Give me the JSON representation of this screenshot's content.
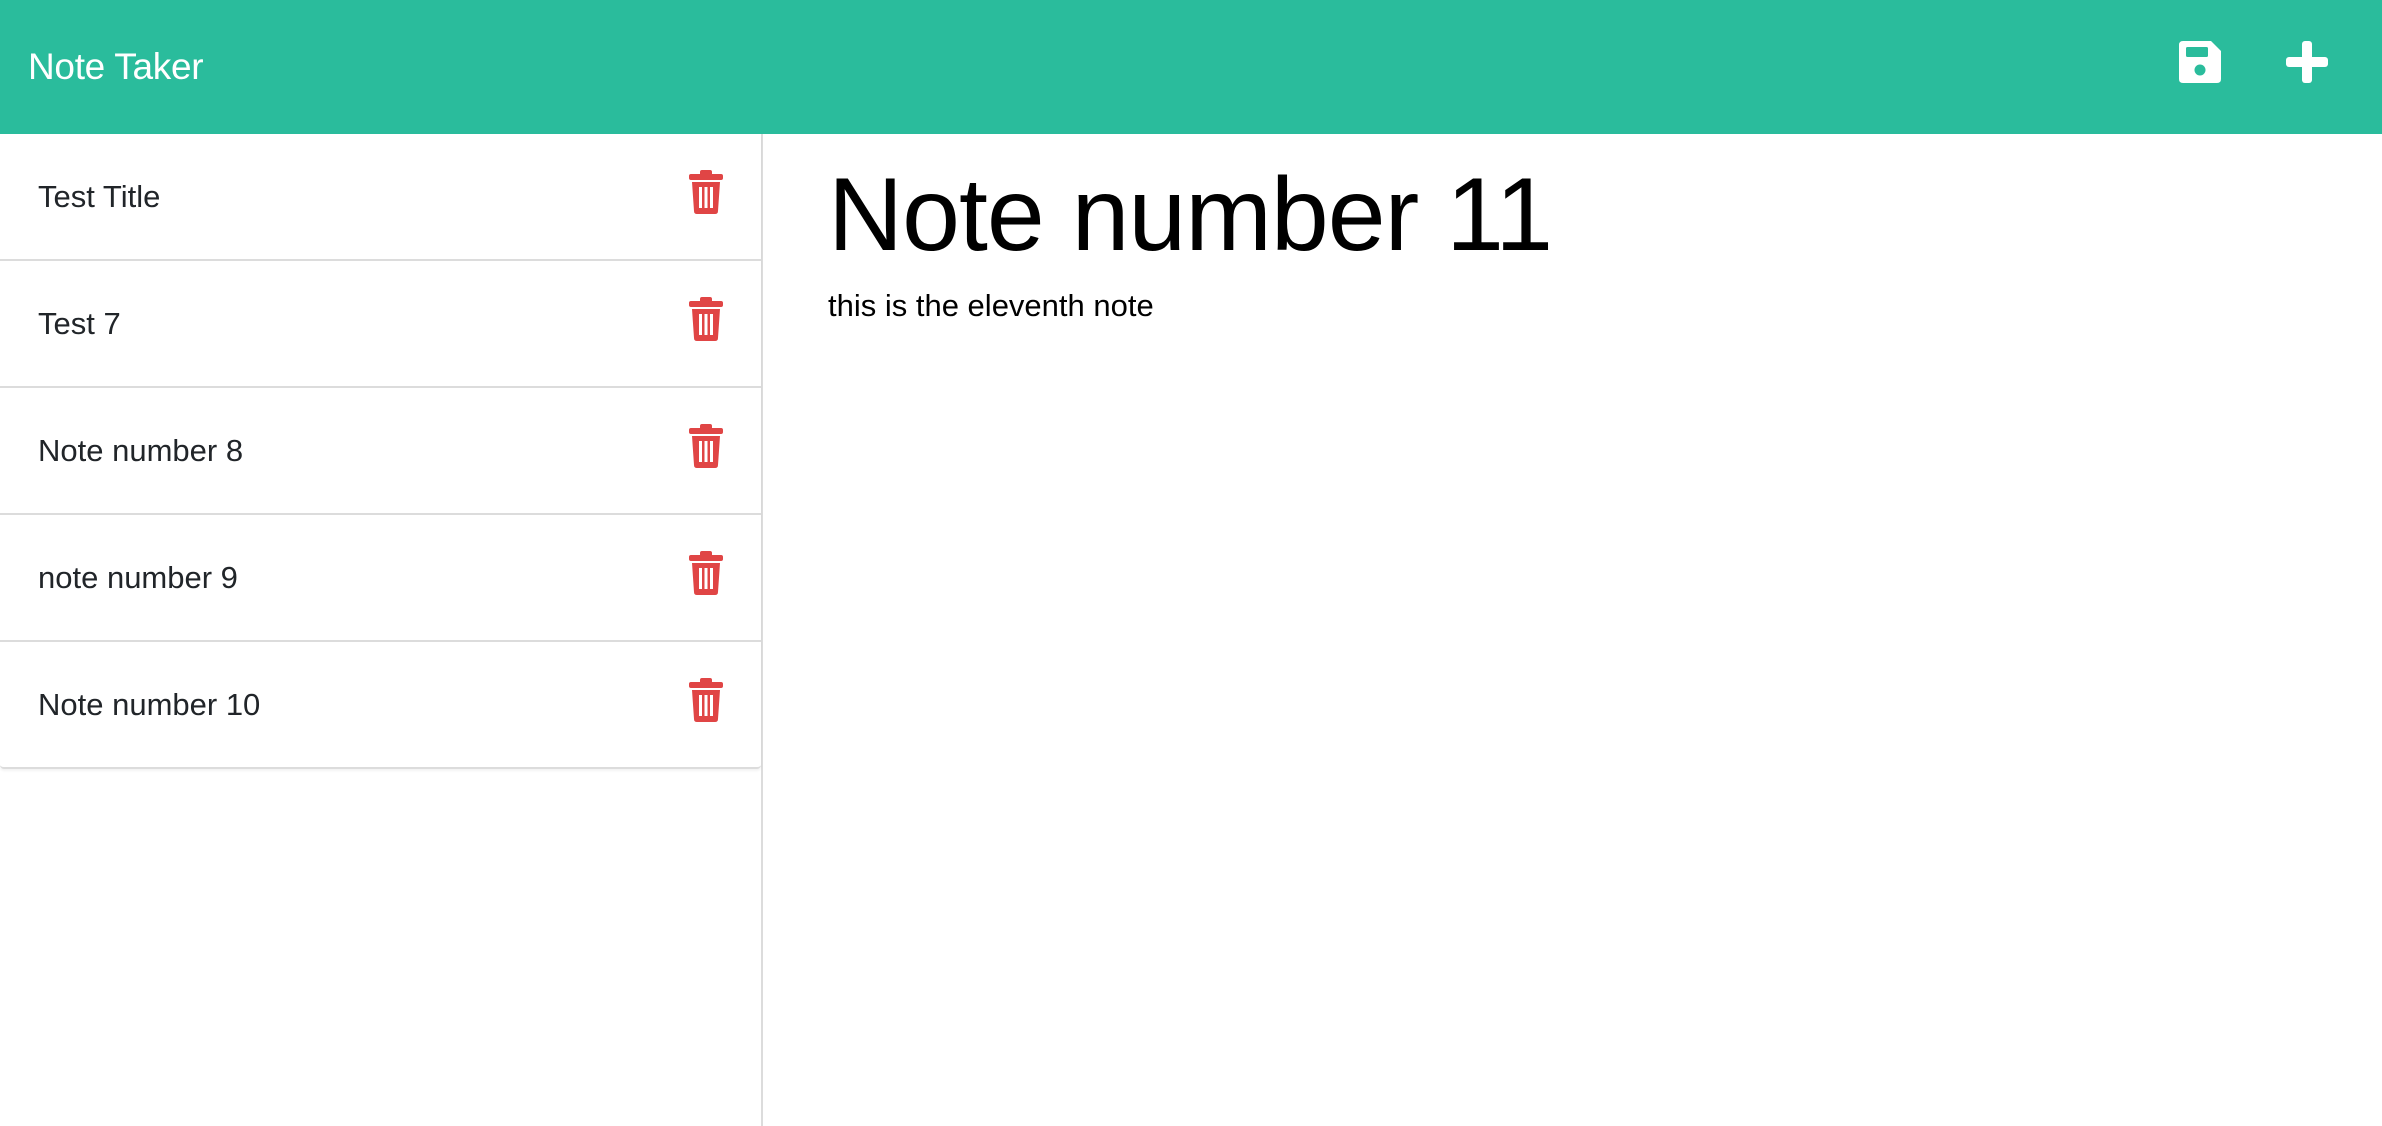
{
  "app": {
    "title": "Note Taker",
    "accent_color": "#2abc9c",
    "delete_color": "#e04545"
  },
  "toolbar": {
    "save_icon": "floppy-disk-icon",
    "new_icon": "plus-icon"
  },
  "sidebar": {
    "notes": [
      {
        "title": "Test Title"
      },
      {
        "title": "Test 7"
      },
      {
        "title": "Note number 8"
      },
      {
        "title": "note number 9"
      },
      {
        "title": "Note number 10"
      }
    ],
    "delete_icon": "trash-icon"
  },
  "main": {
    "note_title": "Note number 11",
    "note_text": "this is the eleventh note"
  }
}
